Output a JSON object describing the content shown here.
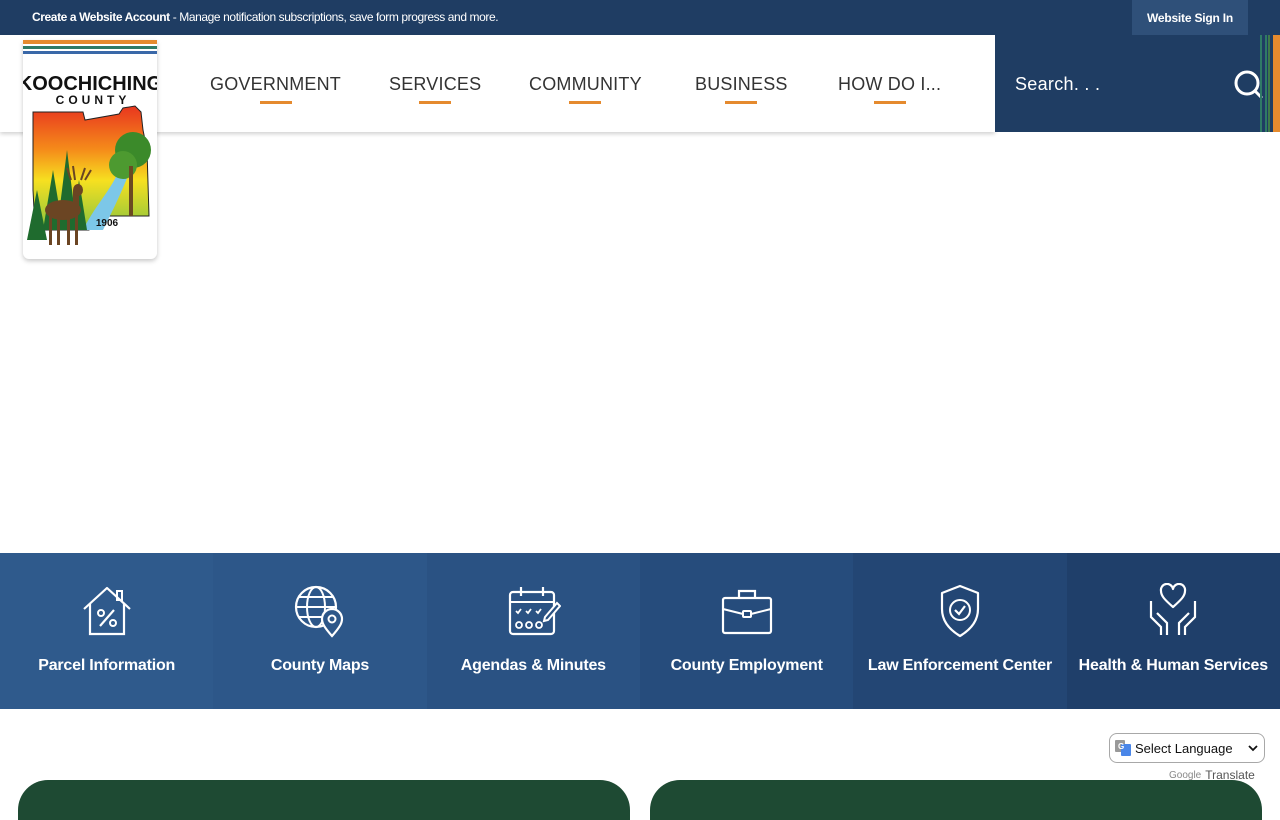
{
  "topbar": {
    "create_account": "Create a Website Account",
    "create_account_desc": " - Manage notification subscriptions, save form progress and more.",
    "sign_in": "Website Sign In"
  },
  "logo": {
    "line1": "KOOCHICHING",
    "line2": "COUNTY",
    "year": "1906"
  },
  "nav": {
    "items": [
      {
        "label": "GOVERNMENT"
      },
      {
        "label": "SERVICES"
      },
      {
        "label": "COMMUNITY"
      },
      {
        "label": "BUSINESS"
      },
      {
        "label": "HOW DO I..."
      }
    ]
  },
  "search": {
    "placeholder": "Search. . ."
  },
  "quick_links": [
    {
      "label": "Parcel Information",
      "icon": "house-percent-icon",
      "color": "#2f5a8c"
    },
    {
      "label": "County Maps",
      "icon": "globe-pin-icon",
      "color": "#2d5789"
    },
    {
      "label": "Agendas & Minutes",
      "icon": "calendar-check-icon",
      "color": "#2a5283"
    },
    {
      "label": "County Employment",
      "icon": "briefcase-icon",
      "color": "#264c7c"
    },
    {
      "label": "Law Enforcement Center",
      "icon": "shield-check-icon",
      "color": "#234674"
    },
    {
      "label": "Health & Human Services",
      "icon": "hands-heart-icon",
      "color": "#1f3f6a"
    }
  ],
  "translate": {
    "select_label": "Select Language",
    "powered_google": "Google",
    "powered_translate": "Translate"
  },
  "colors": {
    "navy": "#1f3d63",
    "accent_orange": "#e58a2e",
    "card_green": "#1e4a33"
  }
}
